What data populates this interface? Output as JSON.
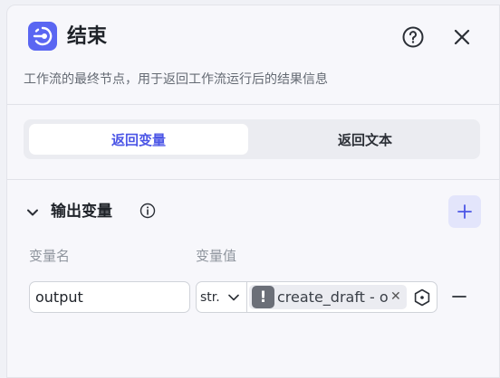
{
  "node": {
    "title": "结束",
    "description": "工作流的最终节点，用于返回工作流运行后的结果信息",
    "icon": "end-node-icon",
    "accent_color": "#5a66f2"
  },
  "header": {
    "help_icon": "help-circle-icon",
    "close_icon": "close-icon"
  },
  "tabs": [
    {
      "label": "返回变量",
      "active": true
    },
    {
      "label": "返回文本",
      "active": false
    }
  ],
  "output_section": {
    "title": "输出变量",
    "info_icon": "info-icon",
    "add_icon": "plus-icon",
    "columns": {
      "name": "变量名",
      "value": "变量值"
    },
    "rows": [
      {
        "name": "output",
        "type": "str.",
        "reference": "create_draft - output",
        "reference_icon": "exclamation-icon"
      }
    ]
  }
}
